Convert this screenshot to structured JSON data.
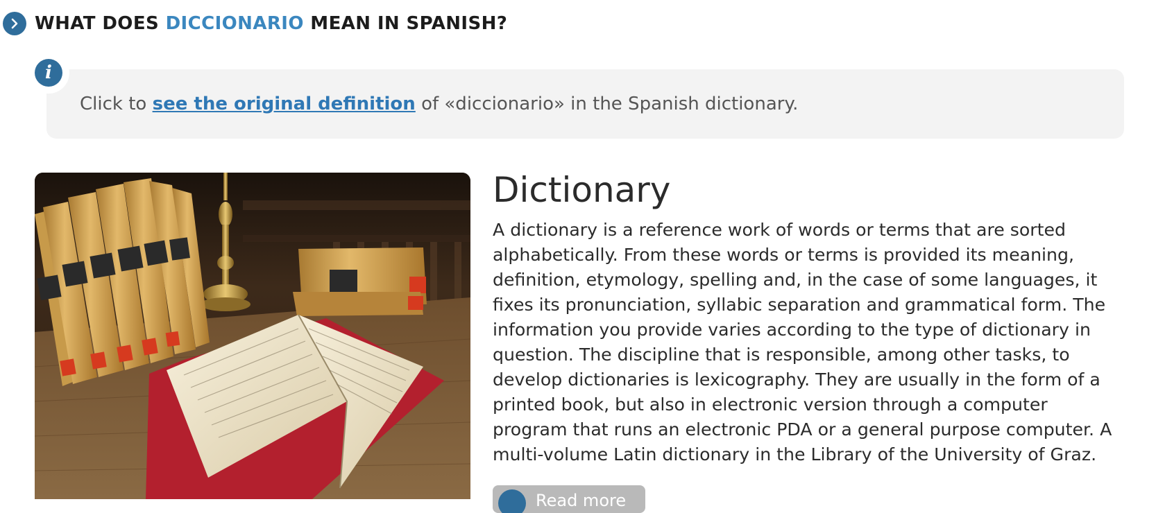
{
  "heading": {
    "prefix": "WHAT DOES ",
    "keyword": "DICCIONARIO",
    "suffix": " MEAN IN SPANISH?"
  },
  "info": {
    "text_before": "Click to ",
    "link_text": "see the original definition",
    "text_after": " of «diccionario» in the Spanish dictionary."
  },
  "entry": {
    "title": "Dictionary",
    "body": "A dictionary is a reference work of words or terms that are sorted alphabetically. From these words or terms is provided its meaning, definition, etymology, spelling and, in the case of some languages, it fixes its pronunciation, syllabic separation and grammatical form. The information you provide varies according to the type of dictionary in question. The discipline that is responsible, among other tasks, to develop dictionaries is lexicography. They are usually in the form of a printed book, but also in electronic version through a computer program that runs an electronic PDA or a general purpose computer. A multi-volume Latin dictionary in the Library of the University of Graz.",
    "read_more_label": "Read more"
  },
  "icons": {
    "heading_icon": "chevron-right-icon",
    "info_icon": "info-icon",
    "read_more_icon": "chevron-right-icon"
  },
  "colors": {
    "accent": "#2f6d9b",
    "keyword": "#3b87bf",
    "link": "#2f78b5",
    "info_bg": "#f3f3f3"
  }
}
